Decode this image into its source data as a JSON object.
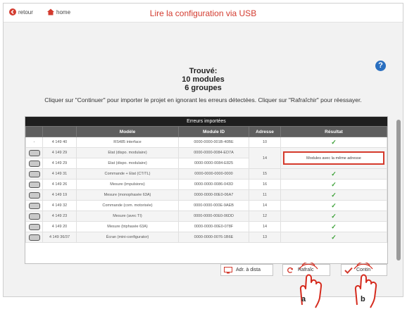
{
  "header": {
    "back_label": "retour",
    "home_label": "home",
    "title": "Lire la configuration via USB"
  },
  "summary": {
    "line1": "Trouvé:",
    "line2": "10 modules",
    "line3": "6 groupes"
  },
  "help_label": "?",
  "instruction": "Cliquer sur \"Continuer\" pour importer le projet en ignorant les erreurs détectées. Cliquer sur \"Rafraîchir\" pour réessayer.",
  "table": {
    "caption": "Erreurs importées",
    "columns": [
      "",
      "",
      "Modèle",
      "Module ID",
      "Adresse",
      "Résultat"
    ],
    "rows": [
      {
        "icon": "-",
        "ref": "4 149 40",
        "model": "RS485 interface",
        "id": "0000-0000-001B-40BE",
        "addr": "10",
        "result": "✓"
      },
      {
        "icon": "device",
        "ref": "4 149 29",
        "model": "Etat (dispo. modulaire)",
        "id": "0000-0000-0084-ED7A",
        "addr": "14",
        "result": "Modules avec la même adresse"
      },
      {
        "icon": "device",
        "ref": "4 149 29",
        "model": "Etat (dispo. modulaire)",
        "id": "0000-0000-0084-E825",
        "addr": "",
        "result": ""
      },
      {
        "icon": "device",
        "ref": "4 149 31",
        "model": "Commande + Etat (CT/TL)",
        "id": "0000-0000-0000-0000",
        "addr": "15",
        "result": "✓"
      },
      {
        "icon": "device",
        "ref": "4 149 26",
        "model": "Mesure (impulsions)",
        "id": "0000-0000-0086-043D",
        "addr": "16",
        "result": "✓"
      },
      {
        "icon": "device",
        "ref": "4 149 19",
        "model": "Mesure (monophasée 63A)",
        "id": "0000-0000-00E0-06A7",
        "addr": "11",
        "result": "✓"
      },
      {
        "icon": "device",
        "ref": "4 149 32",
        "model": "Commande (com. motorisée)",
        "id": "0000-0000-000E-9AEB",
        "addr": "14",
        "result": "✓"
      },
      {
        "icon": "device",
        "ref": "4 149 23",
        "model": "Mesure (avec TI)",
        "id": "0000-0000-00E0-06DD",
        "addr": "12",
        "result": "✓"
      },
      {
        "icon": "device",
        "ref": "4 149 20",
        "model": "Mesure (triphasée 63A)",
        "id": "0000-0000-00E0-078F",
        "addr": "14",
        "result": "✓"
      },
      {
        "icon": "device",
        "ref": "4 149 36/37",
        "model": "Écran (mini-configurator)",
        "id": "0000-0000-0076-1B6E",
        "addr": "13",
        "result": "✓"
      }
    ]
  },
  "buttons": {
    "adr": "Adr. à dista",
    "refresh": "Rafraîc",
    "continue": "Contin"
  },
  "markers": {
    "a": "a",
    "b": "b"
  },
  "icons": {
    "back": "back-arrow-icon",
    "home": "home-icon",
    "help": "help-icon",
    "device": "device-icon",
    "check": "check-icon",
    "monitor": "monitor-icon",
    "refresh": "refresh-icon",
    "continue": "checkmark-icon"
  },
  "colors": {
    "title": "#d33b2f",
    "help": "#2a6fc0",
    "success": "#3aa035",
    "error_border": "#d53a2c"
  }
}
